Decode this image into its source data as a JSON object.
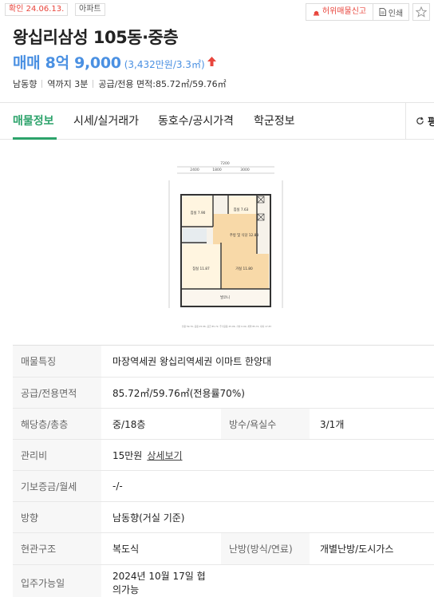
{
  "header": {
    "confirm_badge": "확인 24.06.13.",
    "type_badge": "아파트",
    "report_label": "허위매물신고",
    "print_label": "인쇄"
  },
  "listing": {
    "title": "왕십리삼성 105동·중층",
    "price_main": "매매 8억 9,000",
    "price_per_area": "(3,432만원/3.3㎡)",
    "info": [
      "남동향",
      "역까지 3분",
      "공급/전용 면적:85.72㎡/59.76㎡"
    ]
  },
  "tabs": [
    {
      "label": "매물정보",
      "active": true
    },
    {
      "label": "시세/실거래가",
      "active": false
    },
    {
      "label": "동호수/공시가격",
      "active": false
    },
    {
      "label": "학군정보",
      "active": false
    }
  ],
  "tab_more_label": "평",
  "details": {
    "features_label": "매물특징",
    "features_value": "마장역세권 왕십리역세권 이마트 한양대",
    "area_label": "공급/전용면적",
    "area_value": "85.72㎡/59.76㎡(전용률70%)",
    "floor_label": "해당층/총층",
    "floor_value": "중/18층",
    "rooms_label": "방수/욕실수",
    "rooms_value": "3/1개",
    "mgmt_label": "관리비",
    "mgmt_value": "15만원",
    "mgmt_link": "상세보기",
    "deposit_label": "기보증금/월세",
    "deposit_value": "-/-",
    "direction_label": "방향",
    "direction_value": "남동향(거실 기준)",
    "entrance_label": "현관구조",
    "entrance_value": "복도식",
    "heating_label": "난방(방식/연료)",
    "heating_value": "개별난방/도시가스",
    "movein_label": "입주가능일",
    "movein_value_line1": "2024년 10월 17일 협",
    "movein_value_line2": "의가능"
  },
  "floorplan": {
    "dims_top": [
      "2400",
      "1800",
      "3000"
    ],
    "total_width": "7200",
    "rooms": [
      "침실 7.90",
      "침실 7.63",
      "주방 및 식당 12.83",
      "침실 11.87",
      "거실 11.80",
      "발코니"
    ],
    "caption": "전용 59.76, 공용 25.96, 공급 85.72, 주거공용 25.96, 기타 0.00, 계약 85.72, 대지 17.87"
  },
  "colors": {
    "price_blue": "#4a90e2",
    "accent_green": "#2ca36b",
    "alert_red": "#e8453c"
  }
}
